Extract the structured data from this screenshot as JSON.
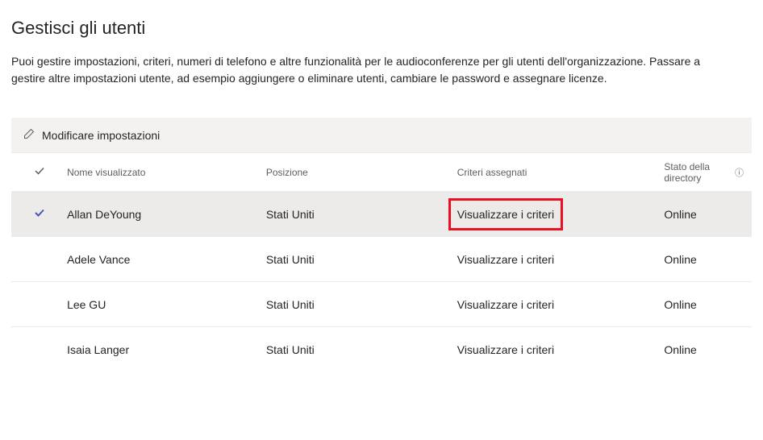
{
  "page": {
    "title": "Gestisci gli utenti",
    "description": "Puoi gestire impostazioni, criteri, numeri di telefono e altre funzionalità per le audioconferenze per gli utenti dell'organizzazione. Passare a gestire altre impostazioni utente, ad esempio aggiungere o eliminare utenti, cambiare le password e assegnare licenze."
  },
  "toolbar": {
    "edit_label": "Modificare impostazioni"
  },
  "table": {
    "headers": {
      "display_name": "Nome visualizzato",
      "location": "Posizione",
      "policies": "Criteri assegnati",
      "directory_status": "Stato della directory"
    },
    "rows": [
      {
        "selected": true,
        "highlighted": true,
        "display_name": "Allan DeYoung",
        "location": "Stati Uniti",
        "policies": "Visualizzare i criteri",
        "directory_status": "Online"
      },
      {
        "selected": false,
        "highlighted": false,
        "display_name": "Adele Vance",
        "location": "Stati Uniti",
        "policies": "Visualizzare i criteri",
        "directory_status": "Online"
      },
      {
        "selected": false,
        "highlighted": false,
        "display_name": "Lee GU",
        "location": "Stati Uniti",
        "policies": "Visualizzare i criteri",
        "directory_status": "Online"
      },
      {
        "selected": false,
        "highlighted": false,
        "display_name": "Isaia Langer",
        "location": "Stati Uniti",
        "policies": "Visualizzare i criteri",
        "directory_status": "Online"
      }
    ]
  }
}
